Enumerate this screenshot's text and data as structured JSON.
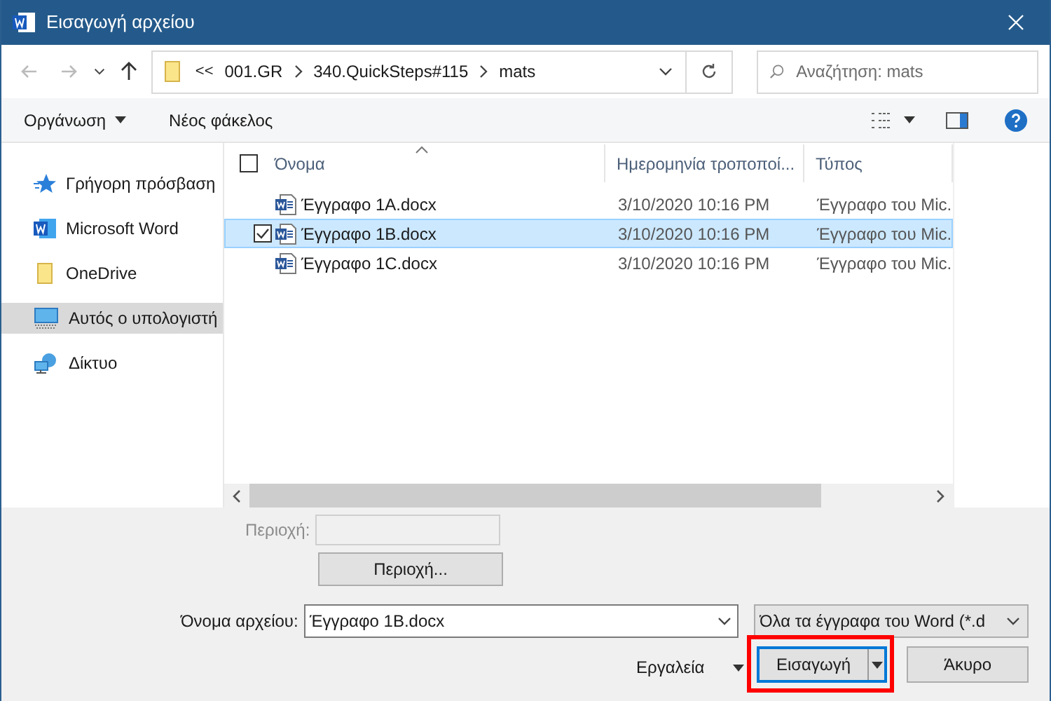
{
  "window": {
    "title": "Εισαγωγή αρχείου"
  },
  "breadcrumb": {
    "overflow": "<<",
    "parts": [
      "001.GR",
      "340.QuickSteps#115",
      "mats"
    ]
  },
  "search": {
    "placeholder": "Αναζήτηση: mats"
  },
  "toolbar": {
    "organize": "Οργάνωση",
    "new_folder": "Νέος φάκελος"
  },
  "sidebar": {
    "items": [
      {
        "label": "Γρήγορη πρόσβαση",
        "kind": "star",
        "selected": false
      },
      {
        "label": "Microsoft Word",
        "kind": "word",
        "selected": false
      },
      {
        "label": "OneDrive",
        "kind": "folder",
        "selected": false
      },
      {
        "label": "Αυτός ο υπολογιστή",
        "kind": "pc",
        "selected": true
      },
      {
        "label": "Δίκτυο",
        "kind": "network",
        "selected": false
      }
    ]
  },
  "table": {
    "select_all": {
      "checked": false
    },
    "columns": [
      "Όνομα",
      "Ημερομηνία τροποποί...",
      "Τύπος"
    ],
    "rows": [
      {
        "name": "Έγγραφο 1A.docx",
        "date": "3/10/2020 10:16 PM",
        "type": "Έγγραφο του Mic.",
        "selected": false
      },
      {
        "name": "Έγγραφο 1B.docx",
        "date": "3/10/2020 10:16 PM",
        "type": "Έγγραφο του Mic.",
        "selected": true
      },
      {
        "name": "Έγγραφο 1C.docx",
        "date": "3/10/2020 10:16 PM",
        "type": "Έγγραφο του Mic.",
        "selected": false
      }
    ]
  },
  "region": {
    "label": "Περιοχή:",
    "button": "Περιοχή...",
    "disabled": true
  },
  "file_name": {
    "label": "Όνομα αρχείου:",
    "value": "Έγγραφο 1B.docx"
  },
  "file_type": {
    "value": "Όλα τα έγγραφα του Word (*.d"
  },
  "tools": "Εργαλεία",
  "insert": {
    "label": "Εισαγωγή",
    "highlighted": true
  },
  "cancel": "Άκυρο"
}
